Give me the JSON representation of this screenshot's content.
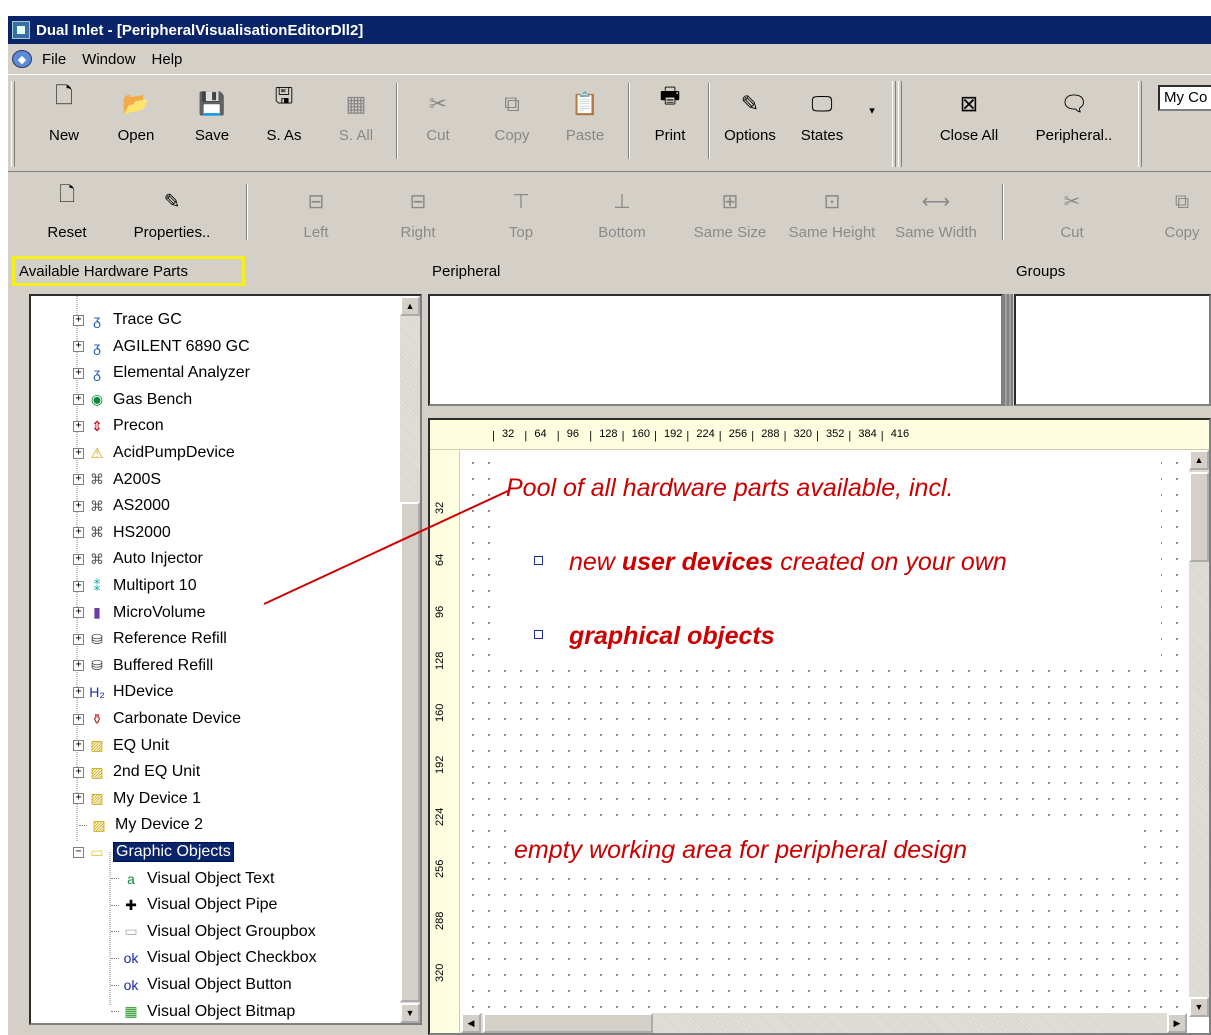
{
  "window": {
    "title": "Dual Inlet - [PeripheralVisualisationEditorDll2]"
  },
  "menu": {
    "items": [
      "File",
      "Window",
      "Help"
    ]
  },
  "toolbar1": {
    "buttons": [
      {
        "label": "New",
        "icon": "new-page-icon",
        "disabled": false
      },
      {
        "label": "Open",
        "icon": "open-folder-icon",
        "disabled": false
      },
      {
        "label": "Save",
        "icon": "floppy-disk-icon",
        "disabled": false
      },
      {
        "label": "S. As",
        "icon": "floppy-save-as-icon",
        "disabled": false
      },
      {
        "label": "S. All",
        "icon": "save-all-icon",
        "disabled": true
      },
      {
        "label": "Cut",
        "icon": "scissors-icon",
        "disabled": true
      },
      {
        "label": "Copy",
        "icon": "copy-icon",
        "disabled": true
      },
      {
        "label": "Paste",
        "icon": "paste-icon",
        "disabled": true
      },
      {
        "label": "Print",
        "icon": "printer-icon",
        "disabled": false
      },
      {
        "label": "Options",
        "icon": "pencil-page-icon",
        "disabled": false
      },
      {
        "label": "States",
        "icon": "states-icon",
        "disabled": false
      },
      {
        "label": "Close All",
        "icon": "close-all-icon",
        "disabled": false
      },
      {
        "label": "Peripheral..",
        "icon": "peripheral-icon",
        "disabled": false
      }
    ],
    "combo_value": "My Co"
  },
  "toolbar2": {
    "buttons": [
      {
        "label": "Reset",
        "icon": "new-page-icon",
        "disabled": false
      },
      {
        "label": "Properties..",
        "icon": "pencil-page-icon",
        "disabled": false
      },
      {
        "label": "Left",
        "icon": "align-left-icon",
        "disabled": true
      },
      {
        "label": "Right",
        "icon": "align-right-icon",
        "disabled": true
      },
      {
        "label": "Top",
        "icon": "align-top-icon",
        "disabled": true
      },
      {
        "label": "Bottom",
        "icon": "align-bottom-icon",
        "disabled": true
      },
      {
        "label": "Same Size",
        "icon": "same-size-icon",
        "disabled": true
      },
      {
        "label": "Same Height",
        "icon": "same-height-icon",
        "disabled": true
      },
      {
        "label": "Same Width",
        "icon": "same-width-icon",
        "disabled": true
      },
      {
        "label": "Cut",
        "icon": "scissors-icon",
        "disabled": true
      },
      {
        "label": "Copy",
        "icon": "copy-icon",
        "disabled": true
      }
    ]
  },
  "headers": {
    "available": "Available Hardware Parts",
    "peripheral": "Peripheral",
    "groups": "Groups"
  },
  "tree": {
    "items": [
      {
        "label": "Trace GC",
        "icon": "gc-icon"
      },
      {
        "label": "AGILENT 6890 GC",
        "icon": "gc-icon"
      },
      {
        "label": "Elemental Analyzer",
        "icon": "gc-icon"
      },
      {
        "label": "Gas Bench",
        "icon": "gas-bench-icon"
      },
      {
        "label": "Precon",
        "icon": "precon-icon"
      },
      {
        "label": "AcidPumpDevice",
        "icon": "warning-icon"
      },
      {
        "label": "A200S",
        "icon": "autosampler-icon"
      },
      {
        "label": "AS2000",
        "icon": "autosampler-icon"
      },
      {
        "label": "HS2000",
        "icon": "autosampler-icon"
      },
      {
        "label": "Auto Injector",
        "icon": "autosampler-icon"
      },
      {
        "label": "Multiport 10",
        "icon": "multiport-icon"
      },
      {
        "label": "MicroVolume",
        "icon": "microvolume-icon"
      },
      {
        "label": "Reference Refill",
        "icon": "refill-icon"
      },
      {
        "label": "Buffered Refill",
        "icon": "refill-icon"
      },
      {
        "label": "HDevice",
        "icon": "h2-icon"
      },
      {
        "label": "Carbonate Device",
        "icon": "carbonate-icon"
      },
      {
        "label": "EQ Unit",
        "icon": "eq-unit-icon"
      },
      {
        "label": "2nd EQ Unit",
        "icon": "eq-unit-icon"
      },
      {
        "label": "My Device 1",
        "icon": "eq-unit-icon"
      },
      {
        "label": "My Device 2",
        "icon": "eq-unit-icon"
      },
      {
        "label": "Graphic Objects",
        "icon": "folder-icon"
      },
      {
        "label": "Visual Object Text",
        "icon": "text-object-icon"
      },
      {
        "label": "Visual Object Pipe",
        "icon": "pipe-cross-icon"
      },
      {
        "label": "Visual Object Groupbox",
        "icon": "groupbox-icon"
      },
      {
        "label": "Visual Object Checkbox",
        "icon": "ok-icon"
      },
      {
        "label": "Visual Object Button",
        "icon": "ok-icon"
      },
      {
        "label": "Visual Object Bitmap",
        "icon": "bitmap-icon"
      }
    ]
  },
  "ruler": {
    "h": [
      "32",
      "64",
      "96",
      "128",
      "160",
      "192",
      "224",
      "256",
      "288",
      "320",
      "352",
      "384",
      "416"
    ],
    "v": [
      "32",
      "64",
      "96",
      "128",
      "160",
      "192",
      "224",
      "256",
      "288",
      "320"
    ]
  },
  "annotations": {
    "pool": "Pool of all hardware parts available, incl.",
    "bullet1_pre": "new ",
    "bullet1_bold": "user devices",
    "bullet1_post": " created on your own",
    "bullet2": "graphical objects",
    "empty": "empty working area for peripheral design"
  },
  "colors": {
    "annotation": "#cc0000",
    "highlight_box": "#f5ef1a",
    "titlebar": "#0a246a"
  }
}
